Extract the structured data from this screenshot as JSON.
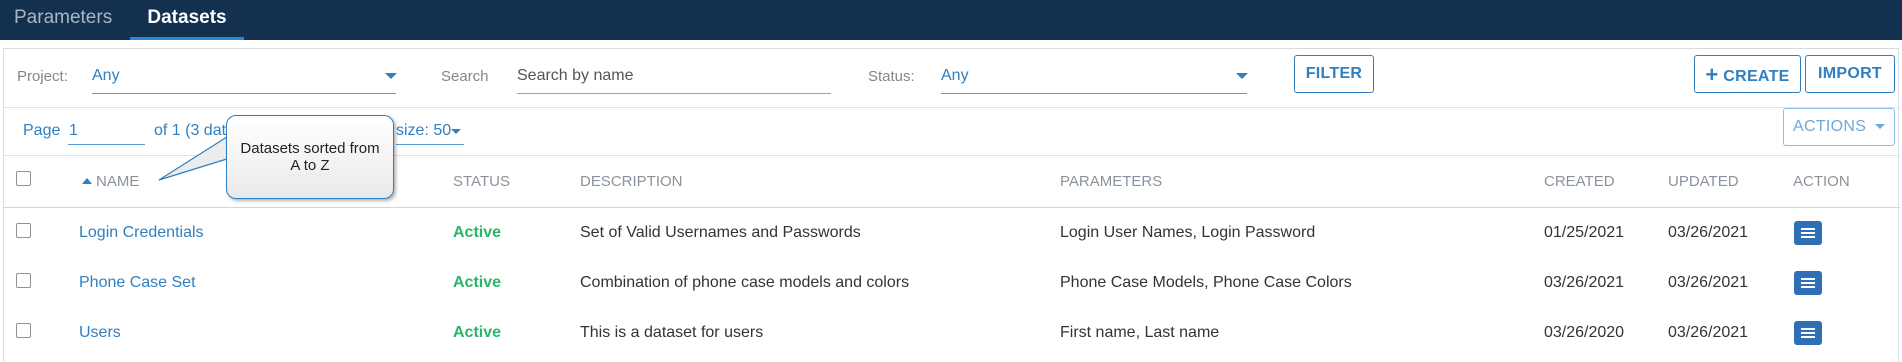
{
  "tabs": [
    {
      "label": "Parameters",
      "active": false
    },
    {
      "label": "Datasets",
      "active": true
    }
  ],
  "filters": {
    "project_label": "Project:",
    "project_value": "Any",
    "search_label": "Search",
    "search_placeholder": "Search by name",
    "status_label": "Status:",
    "status_value": "Any",
    "filter_button": "FILTER"
  },
  "toolbar": {
    "create_button": "CREATE",
    "import_button": "IMPORT",
    "actions_button": "ACTIONS"
  },
  "pagination": {
    "page_label": "Page",
    "page_value": "1",
    "of_text": "of 1 (3 dat",
    "size_text": "size: 50"
  },
  "callout": {
    "line1": "Datasets sorted from",
    "line2": "A to Z"
  },
  "table": {
    "headers": {
      "name": "NAME",
      "status": "STATUS",
      "description": "DESCRIPTION",
      "parameters": "PARAMETERS",
      "created": "CREATED",
      "updated": "UPDATED",
      "action": "ACTION"
    },
    "sort": {
      "column": "name",
      "direction": "ascending"
    },
    "rows": [
      {
        "name": "Login Credentials",
        "status": "Active",
        "description": "Set of Valid Usernames and Passwords",
        "parameters": "Login User Names, Login Password",
        "created": "01/25/2021",
        "updated": "03/26/2021"
      },
      {
        "name": "Phone Case Set",
        "status": "Active",
        "description": "Combination of phone case models and colors",
        "parameters": "Phone Case Models, Phone Case Colors",
        "created": "03/26/2021",
        "updated": "03/26/2021"
      },
      {
        "name": "Users",
        "status": "Active",
        "description": "This is a dataset for users",
        "parameters": "First name, Last name",
        "created": "03/26/2020",
        "updated": "03/26/2021"
      }
    ]
  },
  "icons": {
    "plus": "plus-icon",
    "menu": "menu-icon",
    "caret": "caret-down-icon",
    "sort": "sort-up-icon"
  },
  "colors": {
    "topbar": "#14304f",
    "accent": "#2f7fc1",
    "active_status": "#2db46a",
    "action_button": "#2f6fb6"
  }
}
